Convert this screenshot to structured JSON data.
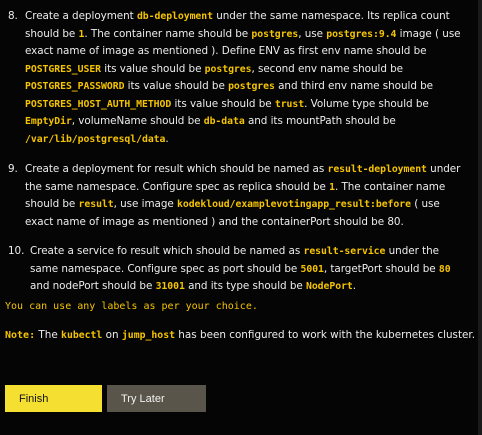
{
  "steps": [
    {
      "number": "8.",
      "p1": "Create a deployment ",
      "c1": "db-deployment",
      "p2": " under the same namespace. Its replica count should be ",
      "c2": "1",
      "p3": ". The container name should be ",
      "c3": "postgres",
      "p4": ", use ",
      "c4": "postgres:9.4",
      "p5": " image ( use exact name of image as mentioned ). Define ENV as first env name should be ",
      "c5": "POSTGRES_USER",
      "p6": " its value should be ",
      "c6": "postgres",
      "p7": ", second env name should be ",
      "c7": "POSTGRES_PASSWORD",
      "p8": " its value should be ",
      "c8": "postgres",
      "p9": " and third env name should be ",
      "c9": "POSTGRES_HOST_AUTH_METHOD",
      "p10": " its value should be ",
      "c10": "trust",
      "p11": ". Volume type should be ",
      "c11": "EmptyDir",
      "p12": ", volumeName should be ",
      "c12": "db-data",
      "p13": " and its mountPath should be ",
      "c13": "/var/lib/postgresql/data",
      "p14": "."
    },
    {
      "number": "9.",
      "p1": "Create a deployment for result which should be named as ",
      "c1": "result-deployment",
      "p2": " under the same namespace. Configure spec as replica should be ",
      "c2": "1",
      "p3": ". The container name should be ",
      "c3": "result",
      "p4": ", use image ",
      "c4": "kodekloud/examplevotingapp_result:before",
      "p5": " ( use exact name of image as mentioned ) and the containerPort should be 80."
    },
    {
      "number": "10.",
      "p1": "Create a service fo result which should be named as ",
      "c1": "result-service",
      "p2": " under the same namespace. Configure spec as port should be ",
      "c2": "5001",
      "p3": ", targetPort should be ",
      "c3": "80",
      "p4": " and nodePort should be ",
      "c4": "31001",
      "p5": " and its type should be ",
      "c5": "NodePort",
      "p6": "."
    }
  ],
  "labels_note": "You can use any labels as per your choice.",
  "kubectl_note": {
    "label": "Note:",
    "t1": " The ",
    "c1": "kubectl",
    "t2": " on ",
    "c2": "jump_host",
    "t3": " has been configured to work with the kubernetes cluster."
  },
  "buttons": {
    "finish": "Finish",
    "try_later": "Try Later"
  },
  "colors": {
    "highlight": "#f5c400",
    "finish_bg": "#f5e032",
    "try_later_bg": "#5a554b",
    "background": "#050505"
  }
}
